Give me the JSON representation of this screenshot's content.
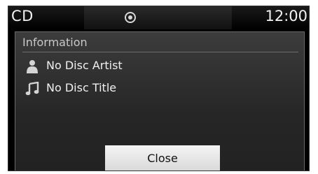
{
  "status_bar": {
    "mode": "CD",
    "source_icon": "disc-icon",
    "clock": "12:00"
  },
  "panel": {
    "title": "Information",
    "artist": {
      "icon": "person-icon",
      "text": "No Disc Artist"
    },
    "track": {
      "icon": "music-note-icon",
      "text": "No Disc Title"
    },
    "close_label": "Close"
  },
  "colors": {
    "screen_bg": "#000000",
    "panel_bg": "#2e2e2e",
    "text": "#f0f0f0",
    "button_bg": "#e6e6e6"
  }
}
